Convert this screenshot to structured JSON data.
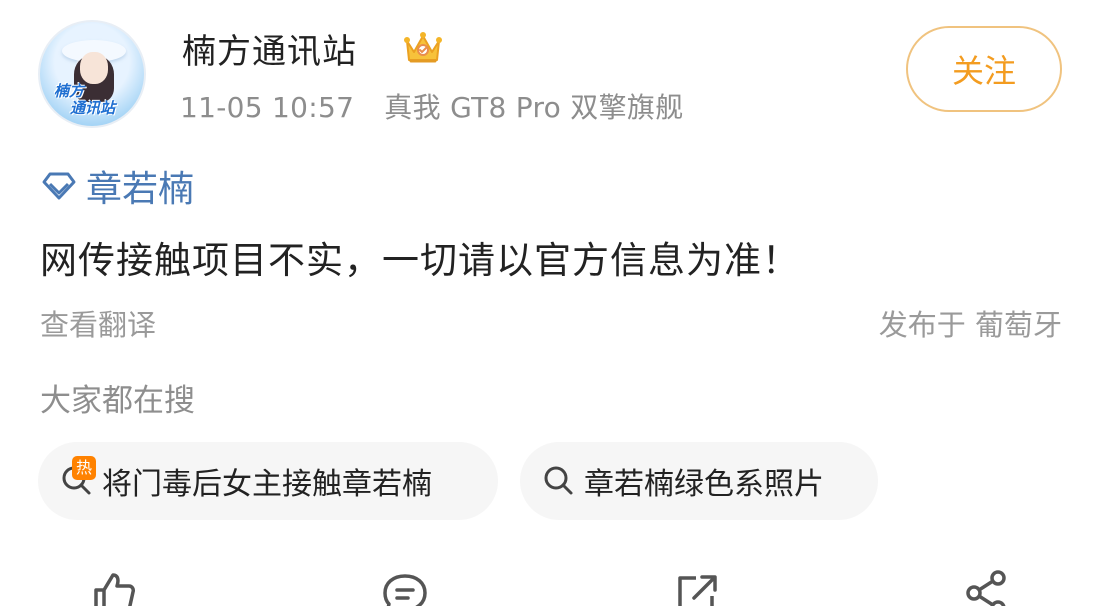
{
  "post": {
    "author": {
      "name": "楠方通讯站",
      "avatar_text": [
        "楠方",
        "通讯站"
      ]
    },
    "timestamp": "11-05 10:57",
    "device": "真我 GT8 Pro 双擎旗舰",
    "follow_label": "关注",
    "topic": "章若楠",
    "text": "网传接触项目不实，一切请以官方信息为准！",
    "translate_label": "查看翻译",
    "location": "发布于 葡萄牙"
  },
  "search": {
    "heading": "大家都在搜",
    "chips": [
      {
        "label": "将门毒后女主接触章若楠",
        "hot_badge": "热",
        "icon": "search-icon"
      },
      {
        "label": "章若楠绿色系照片",
        "icon": "search-icon"
      }
    ]
  },
  "actions": {
    "icons": [
      "like-icon",
      "comment-icon",
      "repost-icon",
      "share-icon"
    ]
  },
  "colors": {
    "follow": "#f39c20",
    "topic": "#4a79b4",
    "hot": "#ff8200"
  }
}
